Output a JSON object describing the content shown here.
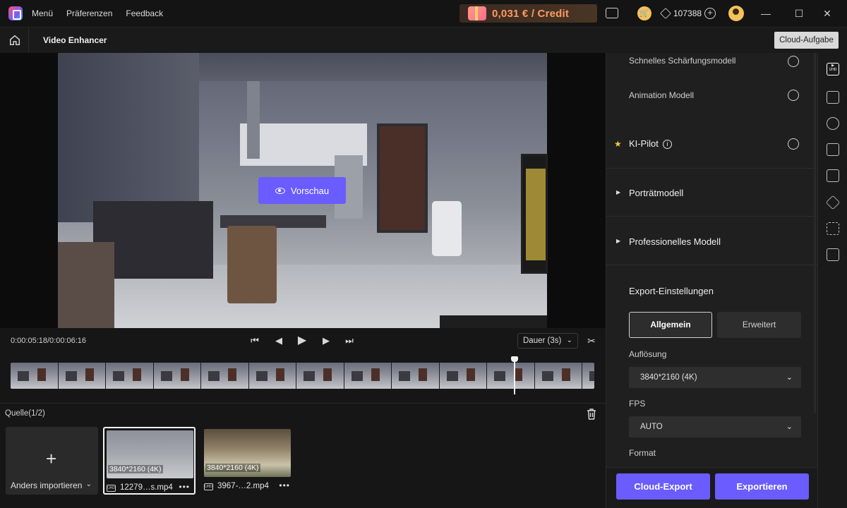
{
  "app": {
    "menu": [
      "Menü",
      "Präferenzen",
      "Feedback"
    ],
    "credit_text": "0,031 € / Credit",
    "gem_count": "107388"
  },
  "subbar": {
    "title": "Video Enhancer",
    "cloud_task_label": "Cloud-Aufgabe"
  },
  "preview": {
    "button_label": "Vorschau"
  },
  "playback": {
    "timecode": "0:00:05:18/0:00:06:16",
    "duration_label": "Dauer (3s)"
  },
  "source": {
    "title": "Quelle(1/2)",
    "add_label": "Anders importieren",
    "items": [
      {
        "resolution": "3840*2160 (4K)",
        "filename": "12279…s.mp4"
      },
      {
        "resolution": "3840*2160 (4K)",
        "filename": "3967-…2.mp4"
      }
    ]
  },
  "panel": {
    "models": [
      {
        "label": "Schnelles Schärfungsmodell"
      },
      {
        "label": "Animation Modell"
      }
    ],
    "ai_pilot": "KI-Pilot",
    "portrait": "Porträtmodell",
    "professional": "Professionelles Modell",
    "export_title": "Export-Einstellungen",
    "tab_general": "Allgemein",
    "tab_advanced": "Erweitert",
    "resolution_label": "Auflösung",
    "resolution_value": "3840*2160 (4K)",
    "fps_label": "FPS",
    "fps_value": "AUTO",
    "format_label": "Format",
    "cloud_export": "Cloud-Export",
    "export": "Exportieren"
  },
  "colors": {
    "accent": "#6a5cff",
    "credit": "#ff9a62",
    "star": "#f4c542"
  }
}
